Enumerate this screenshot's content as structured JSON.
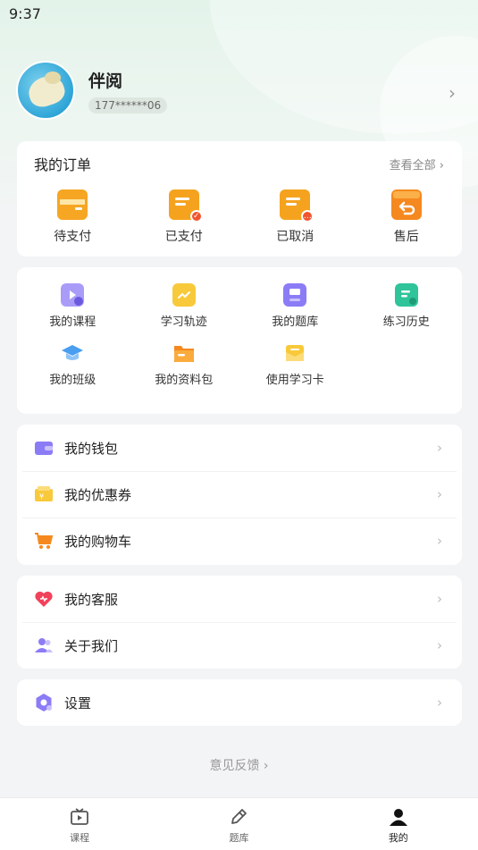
{
  "status_bar": {
    "time": "9:37"
  },
  "profile": {
    "name": "伴阅",
    "phone": "177******06"
  },
  "orders": {
    "title": "我的订单",
    "view_all": "查看全部 ›",
    "items": [
      {
        "label": "待支付",
        "icon": "wallet-card-icon",
        "color": "#f6a623"
      },
      {
        "label": "已支付",
        "icon": "receipt-check-icon",
        "color": "#f5a31f"
      },
      {
        "label": "已取消",
        "icon": "receipt-cancel-icon",
        "color": "#f5a31f"
      },
      {
        "label": "售后",
        "icon": "return-box-icon",
        "color": "#f5891f"
      }
    ]
  },
  "tools": {
    "items": [
      {
        "label": "我的课程",
        "icon": "course-play-icon",
        "color": "#8b7cf6"
      },
      {
        "label": "学习轨迹",
        "icon": "learning-track-icon",
        "color": "#f8c93a"
      },
      {
        "label": "我的题库",
        "icon": "question-bank-icon",
        "color": "#8b7cf6"
      },
      {
        "label": "练习历史",
        "icon": "practice-history-icon",
        "color": "#2fc49a"
      },
      {
        "label": "我的班级",
        "icon": "graduation-cap-icon",
        "color": "#4a9ef0"
      },
      {
        "label": "我的资料包",
        "icon": "folder-icon",
        "color": "#f5891f"
      },
      {
        "label": "使用学习卡",
        "icon": "study-card-icon",
        "color": "#f8c93a"
      }
    ]
  },
  "wallet_group": {
    "items": [
      {
        "label": "我的钱包",
        "icon": "wallet-icon"
      },
      {
        "label": "我的优惠券",
        "icon": "coupon-icon"
      },
      {
        "label": "我的购物车",
        "icon": "cart-icon"
      }
    ]
  },
  "service_group": {
    "items": [
      {
        "label": "我的客服",
        "icon": "heart-icon"
      },
      {
        "label": "关于我们",
        "icon": "people-icon"
      }
    ]
  },
  "settings": {
    "label": "设置",
    "icon": "settings-icon"
  },
  "feedback": {
    "label": "意见反馈 ›"
  },
  "tabbar": {
    "tabs": [
      {
        "label": "课程",
        "icon": "tv-play-icon"
      },
      {
        "label": "题库",
        "icon": "pencil-icon"
      },
      {
        "label": "我的",
        "icon": "person-icon"
      }
    ],
    "active": "我的"
  },
  "colors": {
    "accent_orange": "#f5a31f",
    "accent_purple": "#8b7cf6",
    "header_bg": "#e3f3ea"
  }
}
